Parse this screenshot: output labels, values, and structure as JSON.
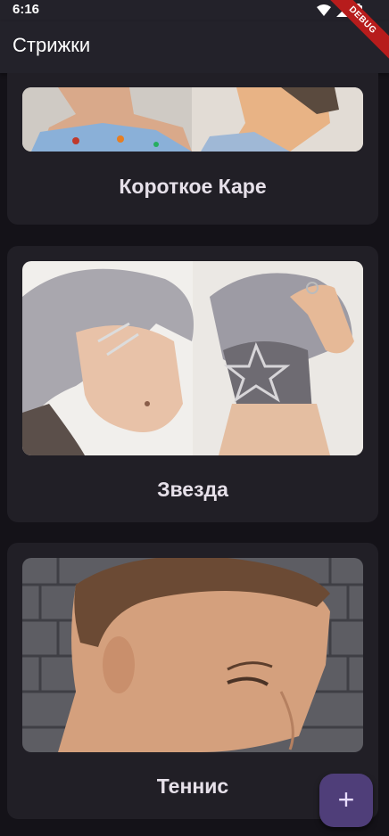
{
  "status_bar": {
    "time": "6:16",
    "icons": [
      "wifi-icon",
      "signal-icon",
      "battery-icon"
    ]
  },
  "debug_banner": "DEBUG",
  "app_bar": {
    "title": "Стрижки"
  },
  "haircuts": [
    {
      "label": "Короткое Каре",
      "image": "short-bob-photo"
    },
    {
      "label": "Звезда",
      "image": "star-undercut-photo"
    },
    {
      "label": "Теннис",
      "image": "tennis-haircut-photo"
    }
  ],
  "fab": {
    "label": "+",
    "icon": "add-icon"
  },
  "colors": {
    "background": "#141218",
    "app_bar": "#23222a",
    "card": "#211f26",
    "fab": "#4f3e79",
    "label": "#e6e0e9"
  }
}
